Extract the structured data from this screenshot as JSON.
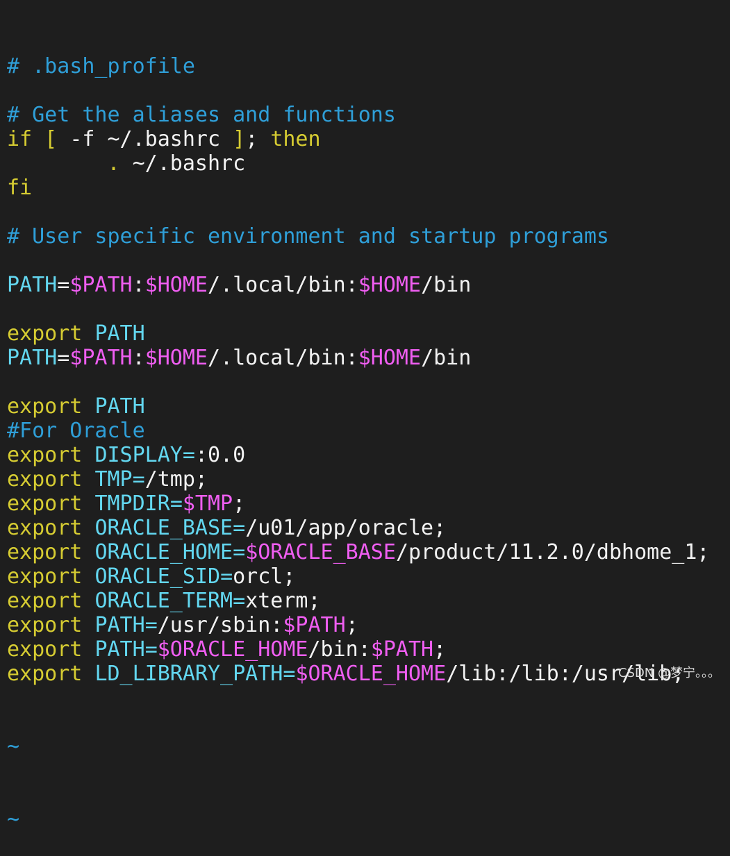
{
  "colors": {
    "background": "#1e1e1e",
    "comment": "#2f9fd8",
    "keyword": "#d6cc32",
    "variable": "#f05ef2",
    "identifier": "#63d7f0",
    "text": "#f2f2f2"
  },
  "editor": {
    "lines": [
      [
        {
          "t": "cmt",
          "v": "# .bash_profile"
        }
      ],
      [],
      [
        {
          "t": "cmt",
          "v": "# Get the aliases and functions"
        }
      ],
      [
        {
          "t": "kw",
          "v": "if [ "
        },
        {
          "t": "txt",
          "v": "-f ~/.bashrc "
        },
        {
          "t": "kw",
          "v": "]"
        },
        {
          "t": "txt",
          "v": "; "
        },
        {
          "t": "kw",
          "v": "then"
        }
      ],
      [
        {
          "t": "txt",
          "v": "        "
        },
        {
          "t": "kw",
          "v": "."
        },
        {
          "t": "txt",
          "v": " ~/.bashrc"
        }
      ],
      [
        {
          "t": "kw",
          "v": "fi"
        }
      ],
      [],
      [
        {
          "t": "cmt",
          "v": "# User specific environment and startup programs"
        }
      ],
      [],
      [
        {
          "t": "id",
          "v": "PATH"
        },
        {
          "t": "txt",
          "v": "="
        },
        {
          "t": "var",
          "v": "$PATH"
        },
        {
          "t": "txt",
          "v": ":"
        },
        {
          "t": "var",
          "v": "$HOME"
        },
        {
          "t": "txt",
          "v": "/.local/bin:"
        },
        {
          "t": "var",
          "v": "$HOME"
        },
        {
          "t": "txt",
          "v": "/bin"
        }
      ],
      [],
      [
        {
          "t": "kw",
          "v": "export"
        },
        {
          "t": "txt",
          "v": " "
        },
        {
          "t": "id",
          "v": "PATH"
        }
      ],
      [
        {
          "t": "id",
          "v": "PATH"
        },
        {
          "t": "txt",
          "v": "="
        },
        {
          "t": "var",
          "v": "$PATH"
        },
        {
          "t": "txt",
          "v": ":"
        },
        {
          "t": "var",
          "v": "$HOME"
        },
        {
          "t": "txt",
          "v": "/.local/bin:"
        },
        {
          "t": "var",
          "v": "$HOME"
        },
        {
          "t": "txt",
          "v": "/bin"
        }
      ],
      [],
      [
        {
          "t": "kw",
          "v": "export"
        },
        {
          "t": "txt",
          "v": " "
        },
        {
          "t": "id",
          "v": "PATH"
        }
      ],
      [
        {
          "t": "cmt",
          "v": "#For Oracle"
        }
      ],
      [
        {
          "t": "kw",
          "v": "export"
        },
        {
          "t": "txt",
          "v": " "
        },
        {
          "t": "id",
          "v": "DISPLAY"
        },
        {
          "t": "id",
          "v": "="
        },
        {
          "t": "txt",
          "v": ":0.0"
        }
      ],
      [
        {
          "t": "kw",
          "v": "export"
        },
        {
          "t": "txt",
          "v": " "
        },
        {
          "t": "id",
          "v": "TMP"
        },
        {
          "t": "id",
          "v": "="
        },
        {
          "t": "txt",
          "v": "/tmp;"
        }
      ],
      [
        {
          "t": "kw",
          "v": "export"
        },
        {
          "t": "txt",
          "v": " "
        },
        {
          "t": "id",
          "v": "TMPDIR"
        },
        {
          "t": "id",
          "v": "="
        },
        {
          "t": "var",
          "v": "$TMP"
        },
        {
          "t": "txt",
          "v": ";"
        }
      ],
      [
        {
          "t": "kw",
          "v": "export"
        },
        {
          "t": "txt",
          "v": " "
        },
        {
          "t": "id",
          "v": "ORACLE_BASE"
        },
        {
          "t": "id",
          "v": "="
        },
        {
          "t": "txt",
          "v": "/u01/app/oracle;"
        }
      ],
      [
        {
          "t": "kw",
          "v": "export"
        },
        {
          "t": "txt",
          "v": " "
        },
        {
          "t": "id",
          "v": "ORACLE_HOME"
        },
        {
          "t": "id",
          "v": "="
        },
        {
          "t": "var",
          "v": "$ORACLE_BASE"
        },
        {
          "t": "txt",
          "v": "/product/11.2.0/dbhome_1;"
        }
      ],
      [
        {
          "t": "kw",
          "v": "export"
        },
        {
          "t": "txt",
          "v": " "
        },
        {
          "t": "id",
          "v": "ORACLE_SID"
        },
        {
          "t": "id",
          "v": "="
        },
        {
          "t": "txt",
          "v": "orcl;"
        }
      ],
      [
        {
          "t": "kw",
          "v": "export"
        },
        {
          "t": "txt",
          "v": " "
        },
        {
          "t": "id",
          "v": "ORACLE_TERM"
        },
        {
          "t": "id",
          "v": "="
        },
        {
          "t": "txt",
          "v": "xterm;"
        }
      ],
      [
        {
          "t": "kw",
          "v": "export"
        },
        {
          "t": "txt",
          "v": " "
        },
        {
          "t": "id",
          "v": "PATH"
        },
        {
          "t": "id",
          "v": "="
        },
        {
          "t": "txt",
          "v": "/usr/sbin:"
        },
        {
          "t": "var",
          "v": "$PATH"
        },
        {
          "t": "txt",
          "v": ";"
        }
      ],
      [
        {
          "t": "kw",
          "v": "export"
        },
        {
          "t": "txt",
          "v": " "
        },
        {
          "t": "id",
          "v": "PATH"
        },
        {
          "t": "id",
          "v": "="
        },
        {
          "t": "var",
          "v": "$ORACLE_HOME"
        },
        {
          "t": "txt",
          "v": "/bin:"
        },
        {
          "t": "var",
          "v": "$PATH"
        },
        {
          "t": "txt",
          "v": ";"
        }
      ],
      [
        {
          "t": "kw",
          "v": "export"
        },
        {
          "t": "txt",
          "v": " "
        },
        {
          "t": "id",
          "v": "LD_LIBRARY_PATH"
        },
        {
          "t": "id",
          "v": "="
        },
        {
          "t": "var",
          "v": "$ORACLE_HOME"
        },
        {
          "t": "txt",
          "v": "/lib:/lib:/usr/lib;"
        }
      ]
    ],
    "tilde_lines": [
      "~",
      "~"
    ]
  },
  "watermark": {
    "text": "CSDN @梦宁。。。"
  }
}
